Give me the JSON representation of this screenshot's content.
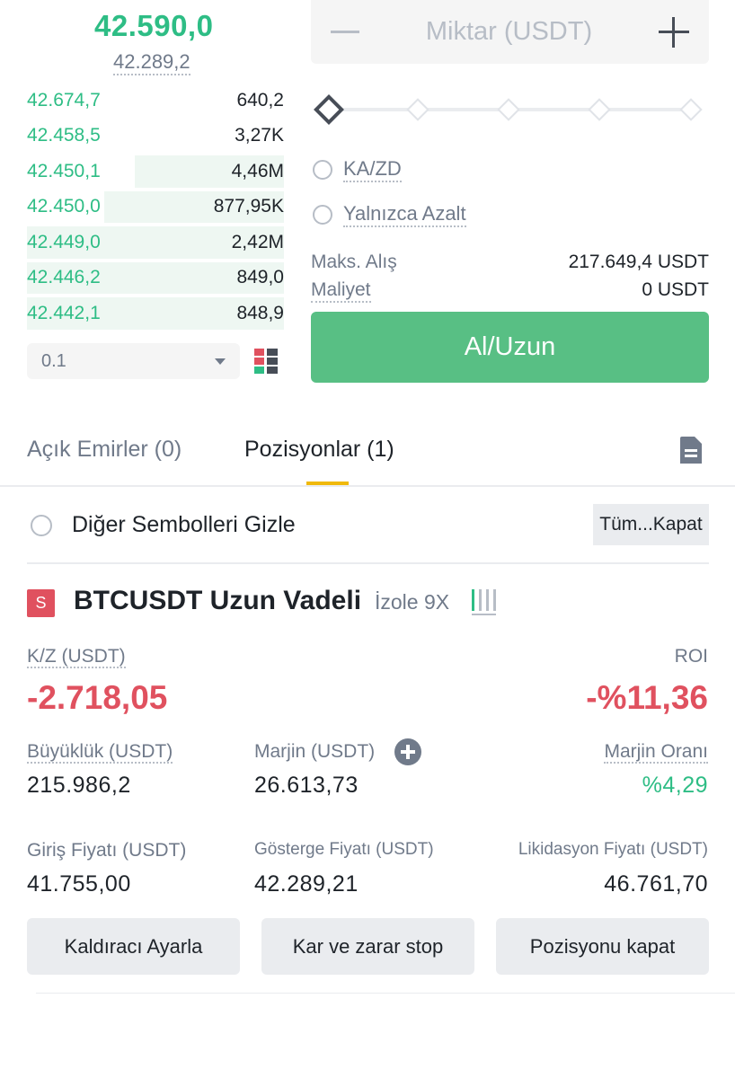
{
  "orderbook": {
    "last_price": "42.590,0",
    "mark_price": "42.289,2",
    "bids": [
      {
        "price": "42.674,7",
        "qty": "640,2",
        "depth": 0.0
      },
      {
        "price": "42.458,5",
        "qty": "3,27K",
        "depth": 0.0
      },
      {
        "price": "42.450,1",
        "qty": "4,46M",
        "depth": 0.58
      },
      {
        "price": "42.450,0",
        "qty": "877,95K",
        "depth": 0.7
      },
      {
        "price": "42.449,0",
        "qty": "2,42M",
        "depth": 1.0
      },
      {
        "price": "42.446,2",
        "qty": "849,0",
        "depth": 1.0
      },
      {
        "price": "42.442,1",
        "qty": "848,9",
        "depth": 1.0
      }
    ],
    "step": "0.1"
  },
  "order_form": {
    "qty_placeholder": "Miktar (USDT)",
    "slider_percent": 0,
    "tpsl_label": "KA/ZD",
    "reduce_only_label": "Yalnızca Azalt",
    "max_buy_label": "Maks. Alış",
    "max_buy_value": "217.649,4 USDT",
    "cost_label": "Maliyet",
    "cost_value": "0 USDT",
    "buy_button": "Al/Uzun"
  },
  "tabs": {
    "open_orders": "Açık Emirler (0)",
    "positions": "Pozisyonlar (1)"
  },
  "filter": {
    "hide_other_symbols": "Diğer Sembolleri Gizle",
    "close_all": "Tüm...Kapat"
  },
  "position": {
    "side_badge": "S",
    "symbol": "BTCUSDT Uzun Vadeli",
    "margin_mode": "İzole 9X",
    "pnl_label": "K/Z (USDT)",
    "pnl_value": "-2.718,05",
    "roi_label": "ROI",
    "roi_value": "-%11,36",
    "size_label": "Büyüklük (USDT)",
    "size_value": "215.986,2",
    "margin_label": "Marjin (USDT)",
    "margin_value": "26.613,73",
    "margin_ratio_label": "Marjin Oranı",
    "margin_ratio_value": "%4,29",
    "entry_label": "Giriş Fiyatı (USDT)",
    "entry_value": "41.755,00",
    "mark_label": "Gösterge Fiyatı (USDT)",
    "mark_value": "42.289,21",
    "liq_label": "Likidasyon Fiyatı (USDT)",
    "liq_value": "46.761,70"
  },
  "actions": {
    "leverage": "Kaldıracı Ayarla",
    "tpsl": "Kar ve zarar stop",
    "close": "Pozisyonu kapat"
  },
  "colors": {
    "buy": "#2ebd85",
    "sell": "#e0515f",
    "accent": "#f0b90b"
  }
}
